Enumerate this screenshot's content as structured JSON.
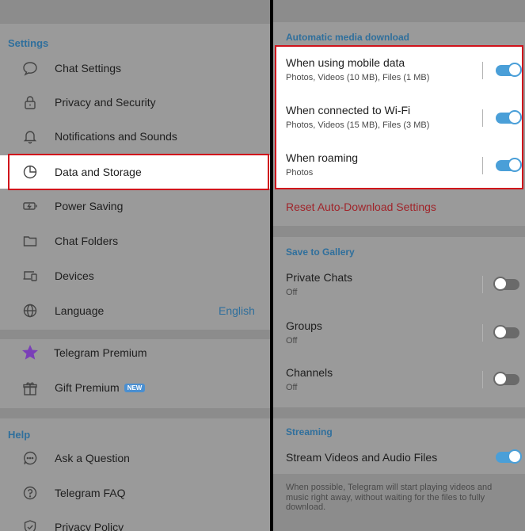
{
  "left": {
    "settings_header": "Settings",
    "items": [
      {
        "label": "Chat Settings",
        "icon": "chat-bubble-icon"
      },
      {
        "label": "Privacy and Security",
        "icon": "lock-icon"
      },
      {
        "label": "Notifications and Sounds",
        "icon": "bell-icon"
      },
      {
        "label": "Data and Storage",
        "icon": "pie-chart-icon"
      },
      {
        "label": "Power Saving",
        "icon": "battery-icon"
      },
      {
        "label": "Chat Folders",
        "icon": "folder-icon"
      },
      {
        "label": "Devices",
        "icon": "devices-icon"
      },
      {
        "label": "Language",
        "icon": "globe-icon",
        "value": "English"
      }
    ],
    "premium": [
      {
        "label": "Telegram Premium",
        "icon": "star-icon"
      },
      {
        "label": "Gift Premium",
        "icon": "gift-icon",
        "badge": "NEW"
      }
    ],
    "help_header": "Help",
    "help": [
      {
        "label": "Ask a Question",
        "icon": "ellipsis-bubble-icon"
      },
      {
        "label": "Telegram FAQ",
        "icon": "question-icon"
      },
      {
        "label": "Privacy Policy",
        "icon": "shield-check-icon"
      }
    ]
  },
  "right": {
    "auto_header": "Automatic media download",
    "auto": [
      {
        "title": "When using mobile data",
        "subtitle": "Photos, Videos (10 MB), Files (1 MB)",
        "on": true
      },
      {
        "title": "When connected to Wi-Fi",
        "subtitle": "Photos, Videos (15 MB), Files (3 MB)",
        "on": true
      },
      {
        "title": "When roaming",
        "subtitle": "Photos",
        "on": true
      }
    ],
    "reset_label": "Reset Auto-Download Settings",
    "gallery_header": "Save to Gallery",
    "gallery": [
      {
        "title": "Private Chats",
        "subtitle": "Off",
        "on": false
      },
      {
        "title": "Groups",
        "subtitle": "Off",
        "on": false
      },
      {
        "title": "Channels",
        "subtitle": "Off",
        "on": false
      }
    ],
    "streaming_header": "Streaming",
    "stream_label": "Stream Videos and Audio Files",
    "stream_on": true,
    "stream_note": "When possible, Telegram will start playing videos and music right away, without waiting for the files to fully download."
  },
  "colors": {
    "accent": "#4a9fd8",
    "highlight": "#d0121b",
    "reset": "#a0242a",
    "star": "#7a3fb8"
  }
}
